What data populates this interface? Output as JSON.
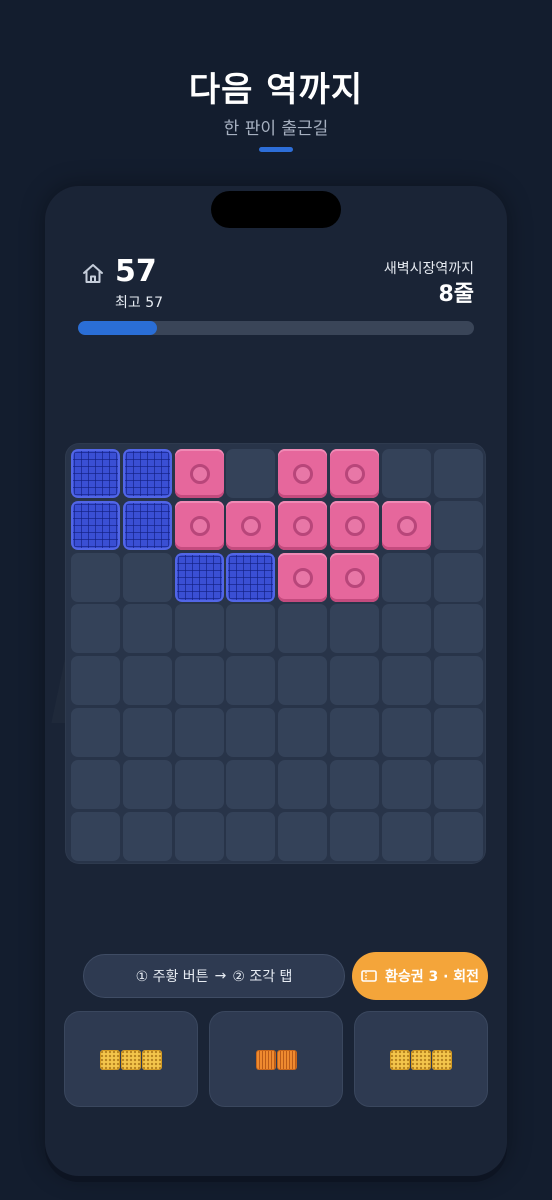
{
  "header": {
    "title": "다음 역까지",
    "subtitle": "한 판이 출근길"
  },
  "hud": {
    "score": "57",
    "best_label": "최고 57",
    "goal_label": "새벽시장역까지",
    "goal_value": "8줄",
    "progress_fraction": 0.2
  },
  "board": {
    "cols": 8,
    "rows": 8,
    "cells": [
      "B",
      "B",
      "P",
      ".",
      "P",
      "P",
      ".",
      ".",
      "B",
      "B",
      "P",
      "P",
      "P",
      "P",
      "P",
      ".",
      ".",
      ".",
      "B",
      "B",
      "P",
      "P",
      ".",
      ".",
      ".",
      ".",
      ".",
      ".",
      ".",
      ".",
      ".",
      ".",
      ".",
      ".",
      ".",
      ".",
      ".",
      ".",
      ".",
      ".",
      ".",
      ".",
      ".",
      ".",
      ".",
      ".",
      ".",
      ".",
      ".",
      ".",
      ".",
      ".",
      ".",
      ".",
      ".",
      ".",
      ".",
      ".",
      ".",
      ".",
      ".",
      ".",
      ".",
      "."
    ]
  },
  "hint": {
    "step1": "① 주황 버튼",
    "arrow": "→",
    "step2": "② 조각 탭"
  },
  "ticket_button": {
    "label": "환승권 3 · 회전"
  },
  "tray": [
    {
      "color": "yellow",
      "blocks": 3
    },
    {
      "color": "orange",
      "blocks": 2
    },
    {
      "color": "yellow",
      "blocks": 3
    }
  ],
  "colors": {
    "accent": "#2a6ed6",
    "pink": "#e6679c",
    "blue": "#3a4fd4",
    "orange": "#f4a53a",
    "yellow": "#f4c54b"
  }
}
